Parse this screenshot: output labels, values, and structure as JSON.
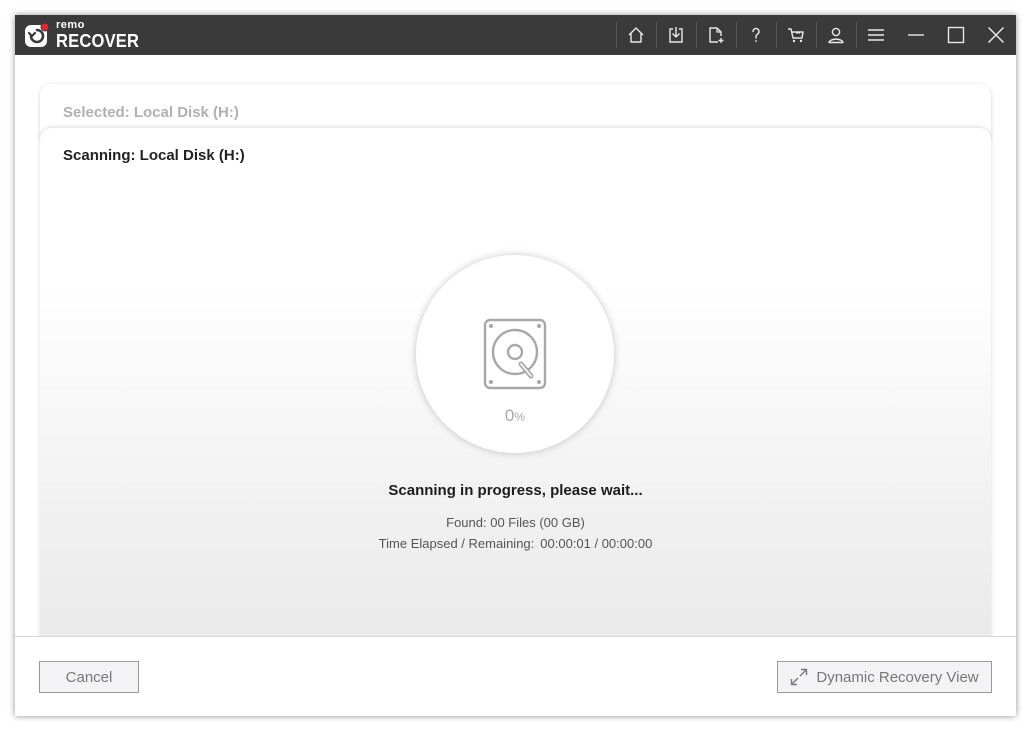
{
  "app": {
    "brand_small": "remo",
    "brand_big": "RECOVER"
  },
  "titlebar": {
    "icons": [
      "home-icon",
      "download-icon",
      "add-file-icon",
      "help-icon",
      "cart-icon",
      "user-icon",
      "menu-icon",
      "minimize-icon",
      "maximize-icon",
      "close-icon"
    ]
  },
  "selected_card": {
    "title": "Selected: Local Disk (H:)"
  },
  "scan_card": {
    "title": "Scanning: Local Disk (H:)",
    "progress_value": "0",
    "progress_unit": "%",
    "progress_fraction": 0,
    "status": "Scanning in progress, please wait...",
    "found": "Found: 00 Files (00 GB)",
    "time_label": "Time Elapsed / Remaining:",
    "time_value": "00:00:01 / 00:00:00"
  },
  "footer": {
    "cancel_label": "Cancel",
    "dynamic_label": "Dynamic Recovery View"
  },
  "colors": {
    "titlebar_bg": "#3a3a3a",
    "brand_accent": "#e3262f",
    "icon_gray": "#a8a8a8"
  }
}
